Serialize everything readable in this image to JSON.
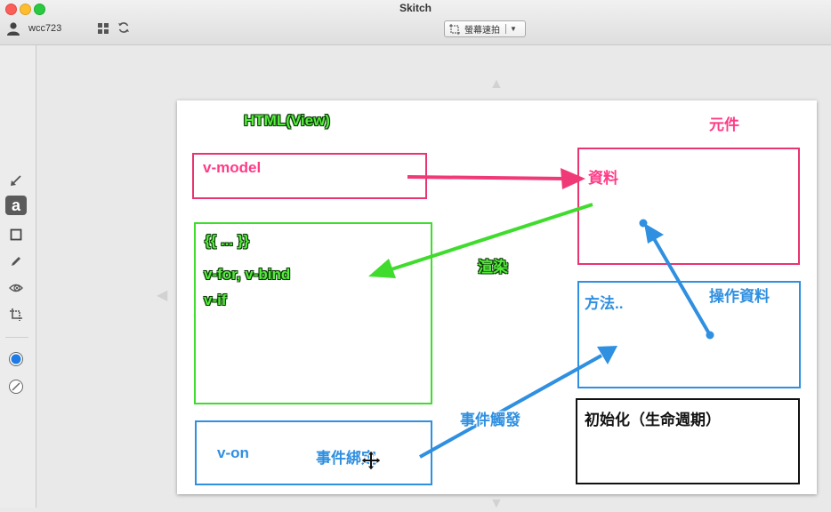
{
  "window": {
    "title": "Skitch"
  },
  "toolbar": {
    "username": "wcc723",
    "capture_label": "螢幕速拍",
    "dropdown_glyph": "▼"
  },
  "tools": [
    {
      "name": "arrow-tool",
      "icon": "arrow-icon",
      "active": false
    },
    {
      "name": "text-tool",
      "icon": "text-a-icon",
      "active": true
    },
    {
      "name": "rectangle-tool",
      "icon": "rectangle-icon",
      "active": false
    },
    {
      "name": "marker-tool",
      "icon": "pen-icon",
      "active": false
    },
    {
      "name": "pixelate-tool",
      "icon": "pixelate-icon",
      "active": false
    },
    {
      "name": "crop-tool",
      "icon": "crop-icon",
      "active": false
    },
    {
      "name": "color-picker",
      "icon": "color-circle-icon",
      "active": false,
      "color": "#1e7be5"
    },
    {
      "name": "stroke-size",
      "icon": "stroke-size-icon",
      "active": false
    }
  ],
  "annotations": {
    "view_title": "HTML(View)",
    "component_title": "元件",
    "v_model": "v-model",
    "data_label": "資料",
    "mustache": "{{ ... }}",
    "v_for_bind": "v-for, v-bind",
    "v_if": "v-if",
    "render_label": "渲染",
    "methods_label": "方法..",
    "operate_data": "操作資料",
    "event_trigger": "事件觸發",
    "lifecycle_label": "初始化（生命週期）",
    "v_on": "v-on",
    "event_binding": "事件綁定"
  },
  "colors": {
    "pink": "#e8346f",
    "green": "#3fdc2e",
    "blue": "#2f8fe0",
    "black": "#111111"
  }
}
